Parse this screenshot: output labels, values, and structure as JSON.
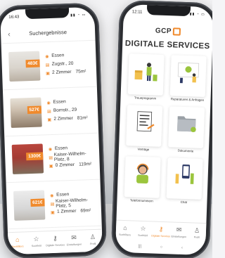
{
  "left_phone": {
    "status_time": "16:43",
    "header_title": "Suchergebnisse",
    "listings": [
      {
        "price": "483€",
        "city": "Essen",
        "street": "Zugstr., 20",
        "rooms": "2 Zimmer",
        "area": "75m²"
      },
      {
        "price": "527€",
        "city": "Essen",
        "street": "Bornstr., 29",
        "rooms": "2 Zimmer",
        "area": "81m²"
      },
      {
        "price": "1300€",
        "city": "Essen",
        "street": "Kaiser-Wilhelm-Platz, 8",
        "rooms": "0 Zimmer",
        "area": "119m²"
      },
      {
        "price": "621€",
        "city": "Essen",
        "street": "Kaiser-Wilhelm-Platz, 5",
        "rooms": "1 Zimmer",
        "area": "69m²"
      }
    ],
    "tabs": [
      {
        "label": "Suchfilters",
        "icon": "home-icon"
      },
      {
        "label": "Suchfeld",
        "icon": "star-icon"
      },
      {
        "label": "Digitale Services",
        "icon": "key-icon"
      },
      {
        "label": "Einstellungen",
        "icon": "mail-icon"
      },
      {
        "label": "Profil",
        "icon": "person-icon"
      }
    ]
  },
  "right_phone": {
    "status_time": "12:11",
    "logo_text": "GCP",
    "title_line1": "DIGITALE SERVICES",
    "services": [
      {
        "label": "Treueprogramm",
        "icon": "gift-icon"
      },
      {
        "label": "Reparaturen & Anfragen",
        "icon": "repair-icon"
      },
      {
        "label": "Verträge",
        "icon": "contract-icon"
      },
      {
        "label": "Dokumente",
        "icon": "folder-icon"
      },
      {
        "label": "Telefonnummern",
        "icon": "headset-icon"
      },
      {
        "label": "Chat",
        "icon": "chat-icon"
      }
    ],
    "tabs": [
      {
        "label": "Suchfilters",
        "icon": "home-icon"
      },
      {
        "label": "Suchfeld",
        "icon": "star-icon"
      },
      {
        "label": "Digitale Services",
        "icon": "key-icon"
      },
      {
        "label": "Einstellungen",
        "icon": "mail-icon"
      },
      {
        "label": "Profil",
        "icon": "person-icon"
      }
    ]
  },
  "colors": {
    "accent": "#f08a2c",
    "frame": "#2b2d31"
  }
}
